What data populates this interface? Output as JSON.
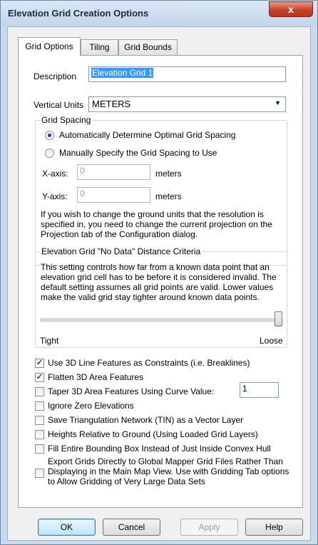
{
  "window": {
    "title": "Elevation Grid Creation Options",
    "close_glyph": "x"
  },
  "tabs": [
    {
      "label": "Grid Options",
      "active": true
    },
    {
      "label": "Tiling",
      "active": false
    },
    {
      "label": "Grid Bounds",
      "active": false
    }
  ],
  "description": {
    "label": "Description",
    "value": "Elevation Grid 1"
  },
  "vertical_units": {
    "label": "Vertical Units",
    "selected": "METERS"
  },
  "grid_spacing": {
    "legend": "Grid Spacing",
    "auto_option": "Automatically Determine Optimal Grid Spacing",
    "manual_option": "Manually Specify the Grid Spacing to Use",
    "selected": "auto",
    "x_label": "X-axis:",
    "x_value": "0",
    "x_unit": "meters",
    "y_label": "Y-axis:",
    "y_value": "0",
    "y_unit": "meters",
    "note": "If you wish to change the ground units that the resolution is specified in, you need to change the current projection on the Projection tab of the Configuration dialog."
  },
  "no_data": {
    "legend": "Elevation Grid \"No Data\" Distance Criteria",
    "description": "This setting controls how far from a known data point that an elevation grid cell has to be before it is considered invalid. The default setting assumes all grid points are valid. Lower values make the valid grid stay tighter around known data points.",
    "slider_level": 1.0,
    "min_label": "Tight",
    "max_label": "Loose"
  },
  "options": [
    {
      "label": "Use 3D Line Features as Constraints (i.e. Breaklines)",
      "checked": true
    },
    {
      "label": "Flatten 3D Area Features",
      "checked": true
    },
    {
      "label": "Taper 3D Area Features Using Curve Value:",
      "checked": false
    },
    {
      "label": "Ignore Zero Elevations",
      "checked": false
    },
    {
      "label": "Save Triangulation Network (TIN) as a Vector Layer",
      "checked": false
    },
    {
      "label": "Heights Relative to Ground (Using Loaded Grid Layers)",
      "checked": false
    },
    {
      "label": "Fill Entire Bounding Box Instead of Just Inside Convex Hull",
      "checked": false
    },
    {
      "label": "Export Grids Directly to Global Mapper Grid Files Rather Than Displaying in the Main Map View. Use with Gridding Tab options to Allow Gridding of Very Large Data Sets",
      "checked": false
    }
  ],
  "curve_value": "1",
  "buttons": {
    "ok": "OK",
    "cancel": "Cancel",
    "apply": "Apply",
    "help": "Help"
  },
  "colors": {
    "title_bar": "#c9daec",
    "close_button": "#c4432a",
    "selection": "#3399ff"
  }
}
